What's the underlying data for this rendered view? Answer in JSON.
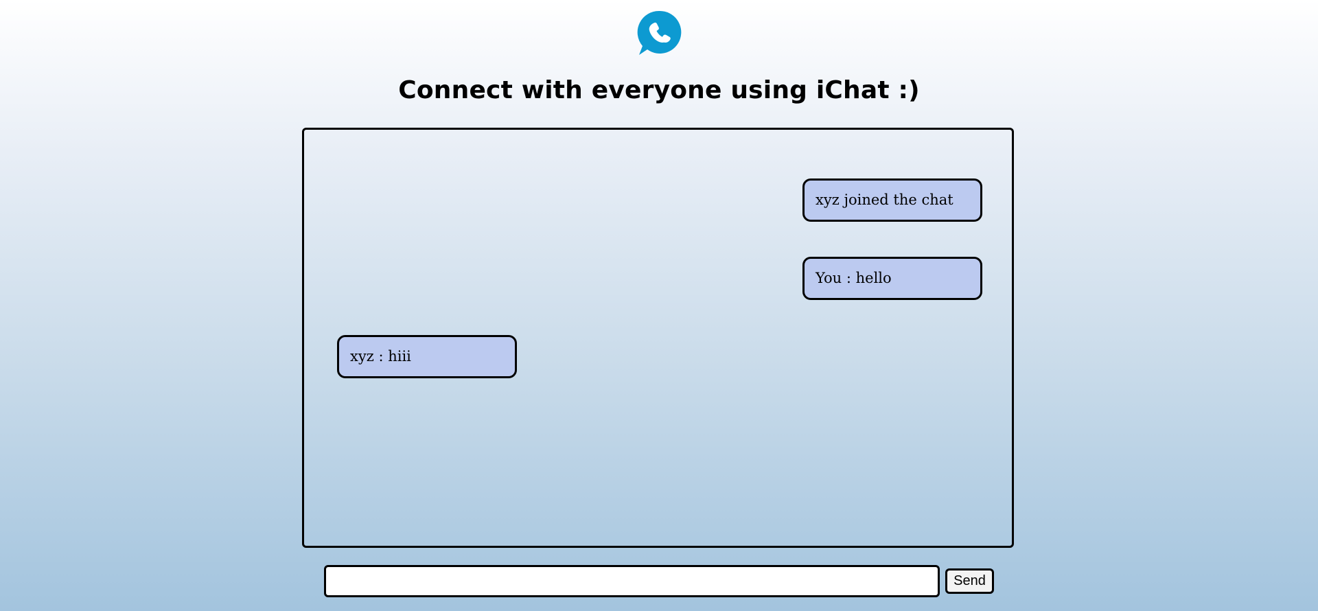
{
  "page": {
    "heading": "Connect with everyone using iChat :)"
  },
  "logo": {
    "icon": "phone-chat-bubble-icon",
    "color": "#0d9ad1"
  },
  "messages": [
    {
      "text": "xyz joined the chat",
      "side": "right"
    },
    {
      "text": "You : hello",
      "side": "right"
    },
    {
      "text": "xyz : hiii",
      "side": "left"
    }
  ],
  "composer": {
    "input_value": "",
    "input_placeholder": "",
    "send_label": "Send"
  },
  "colors": {
    "message_bubble": "#bccaf0",
    "border": "#000000"
  }
}
